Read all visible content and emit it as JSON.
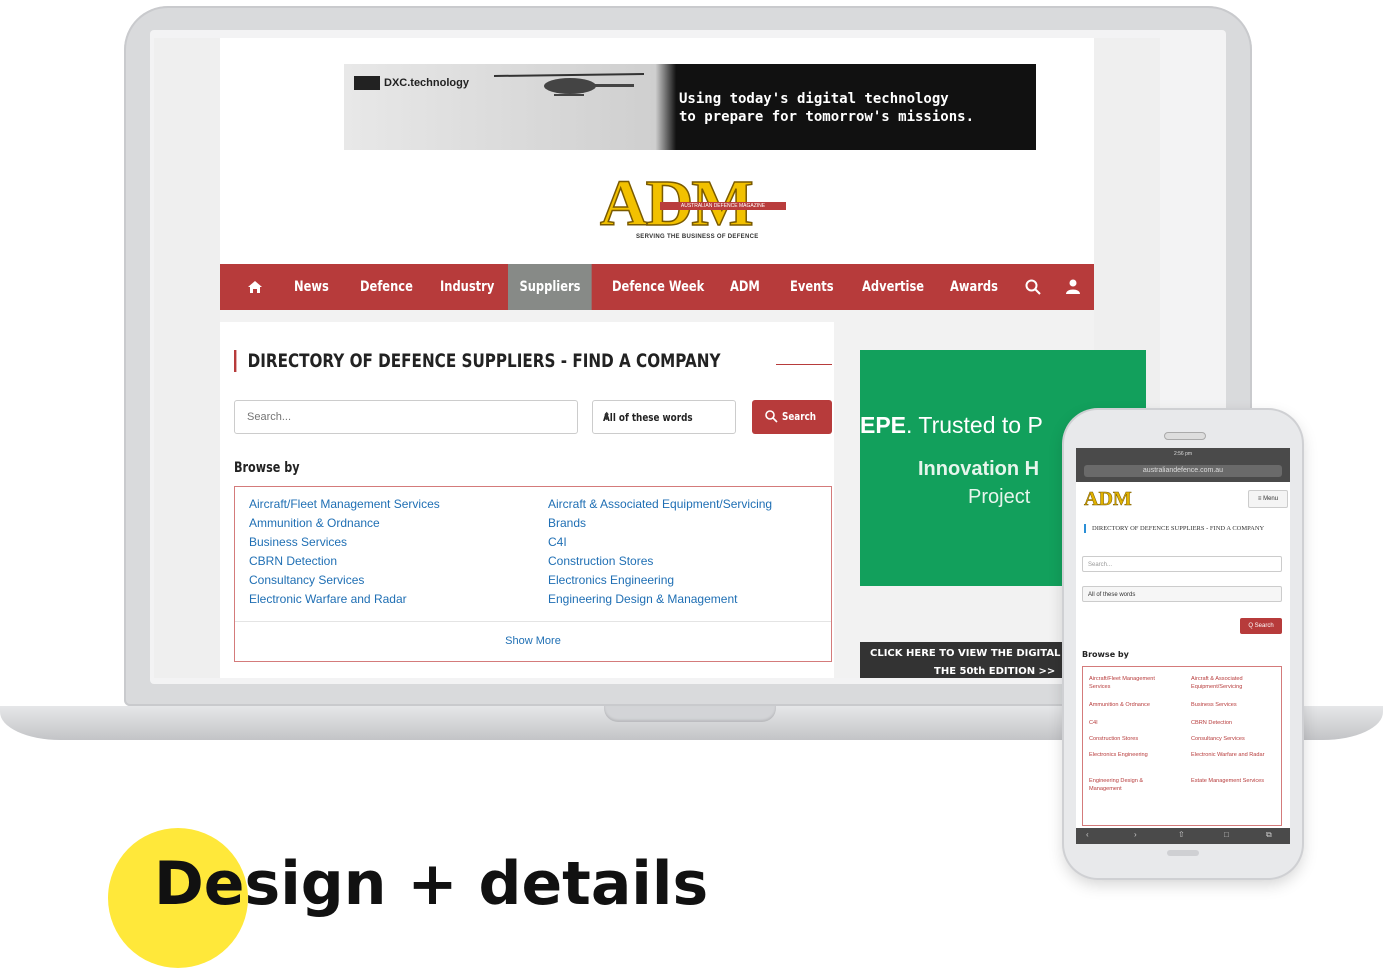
{
  "ad_banner": {
    "brand": "DXC.technology",
    "text_line1": "Using today's digital technology",
    "text_line2": "to prepare for tomorrow's missions."
  },
  "logo": {
    "name": "ADM",
    "subtitle": "AUSTRALIAN DEFENCE MAGAZINE",
    "tagline": "SERVING THE BUSINESS OF DEFENCE"
  },
  "nav": {
    "items": [
      {
        "label": "News"
      },
      {
        "label": "Defence"
      },
      {
        "label": "Industry"
      },
      {
        "label": "Suppliers"
      },
      {
        "label": "Defence Week"
      },
      {
        "label": "ADM"
      },
      {
        "label": "Events"
      },
      {
        "label": "Advertise"
      },
      {
        "label": "Awards"
      }
    ],
    "active": "Suppliers",
    "icons": [
      "home-icon",
      "search-icon",
      "user-icon"
    ]
  },
  "directory": {
    "heading": "DIRECTORY OF DEFENCE SUPPLIERS - FIND A COMPANY",
    "search_placeholder": "Search...",
    "match_option": "All of these words",
    "search_button": "Search",
    "browse_title": "Browse by",
    "categories_left": [
      "Aircraft/Fleet Management Services",
      "Ammunition & Ordnance",
      "Business Services",
      "CBRN Detection",
      "Consultancy Services",
      "Electronic Warfare and Radar"
    ],
    "categories_right": [
      "Aircraft & Associated Equipment/Servicing",
      "Brands",
      "C4I",
      "Construction Stores",
      "Electronics Engineering",
      "Engineering Design & Management"
    ],
    "show_more": "Show More"
  },
  "side_ad": {
    "line1_bold": "EPE",
    "line1_rest": ". Trusted to P",
    "line2": "Innovation H",
    "line3": "Project",
    "color": "#12a05c"
  },
  "digital_edition": {
    "line1": "CLICK HERE TO VIEW THE DIGITAL",
    "line2": "THE 50th EDITION >>"
  },
  "phone": {
    "status_time": "2:56 pm",
    "url": "australiandefence.com.au",
    "logo": "ADM",
    "menu_label": "≡ Menu",
    "heading": "DIRECTORY OF DEFENCE SUPPLIERS - FIND A COMPANY",
    "search_placeholder": "Search...",
    "match_option": "All of these words",
    "search_button": "Q Search",
    "browse_title": "Browse by",
    "categories": [
      "Aircraft/Fleet Management Services",
      "Aircraft & Associated Equipment/Servicing",
      "Ammunition & Ordnance",
      "Business Services",
      "C4I",
      "CBRN Detection",
      "Construction Stores",
      "Consultancy Services",
      "Electronics Engineering",
      "Electronic Warfare and Radar",
      "Engineering Design & Management",
      "Estate Management Services"
    ]
  },
  "bottom_title": "Design + details",
  "colors": {
    "brand_red": "#b73b3b",
    "nav_active": "#878a87",
    "link_blue": "#1f6fb4",
    "badge_yellow": "#ffe83a"
  }
}
